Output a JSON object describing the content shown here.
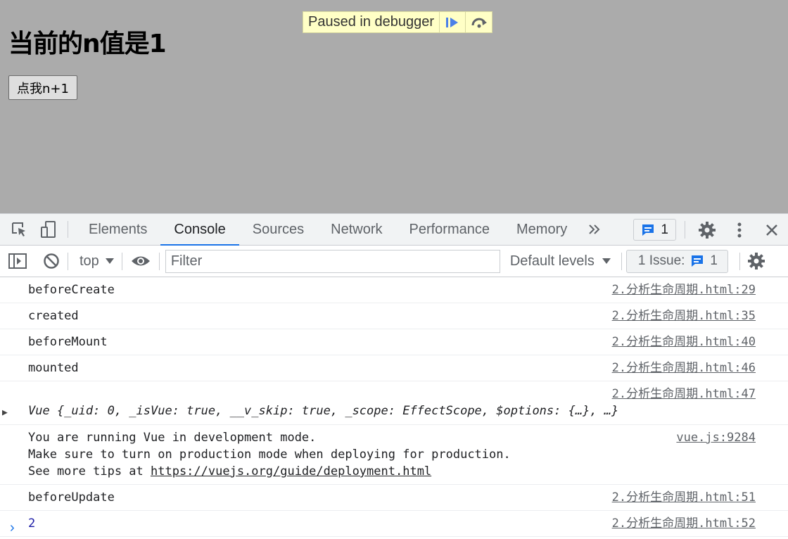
{
  "page": {
    "heading": "当前的n值是1",
    "increment_button": "点我n+1"
  },
  "debugger_overlay": {
    "message": "Paused in debugger",
    "resume_icon": "resume-icon",
    "step_over_icon": "step-over-icon"
  },
  "devtools": {
    "tabs": [
      {
        "label": "Elements",
        "active": false
      },
      {
        "label": "Console",
        "active": true
      },
      {
        "label": "Sources",
        "active": false
      },
      {
        "label": "Network",
        "active": false
      },
      {
        "label": "Performance",
        "active": false
      },
      {
        "label": "Memory",
        "active": false
      }
    ],
    "more_tabs": "»",
    "message_count": "1",
    "toolbar": {
      "context": "top",
      "filter_placeholder": "Filter",
      "levels": "Default levels",
      "issues_label": "1 Issue:",
      "issues_count": "1"
    },
    "accent_color": "#1a73e8"
  },
  "console": {
    "messages": [
      {
        "text": "beforeCreate",
        "source": "2.分析生命周期.html:29"
      },
      {
        "text": "created",
        "source": "2.分析生命周期.html:35"
      },
      {
        "text": "beforeMount",
        "source": "2.分析生命周期.html:40"
      },
      {
        "text": "mounted",
        "source": "2.分析生命周期.html:46"
      },
      {
        "text": "Vue {_uid: 0, _isVue: true, __v_skip: true, _scope: EffectScope, $options: {…}, …}",
        "source": "2.分析生命周期.html:47"
      },
      {
        "line1": "You are running Vue in development mode.",
        "line2": "Make sure to turn on production mode when deploying for production.",
        "line3_prefix": "See more tips at ",
        "link": "https://vuejs.org/guide/deployment.html",
        "source": "vue.js:9284"
      },
      {
        "text": "beforeUpdate",
        "source": "2.分析生命周期.html:51"
      },
      {
        "text": "2",
        "source": "2.分析生命周期.html:52"
      }
    ],
    "prompt": "›"
  }
}
